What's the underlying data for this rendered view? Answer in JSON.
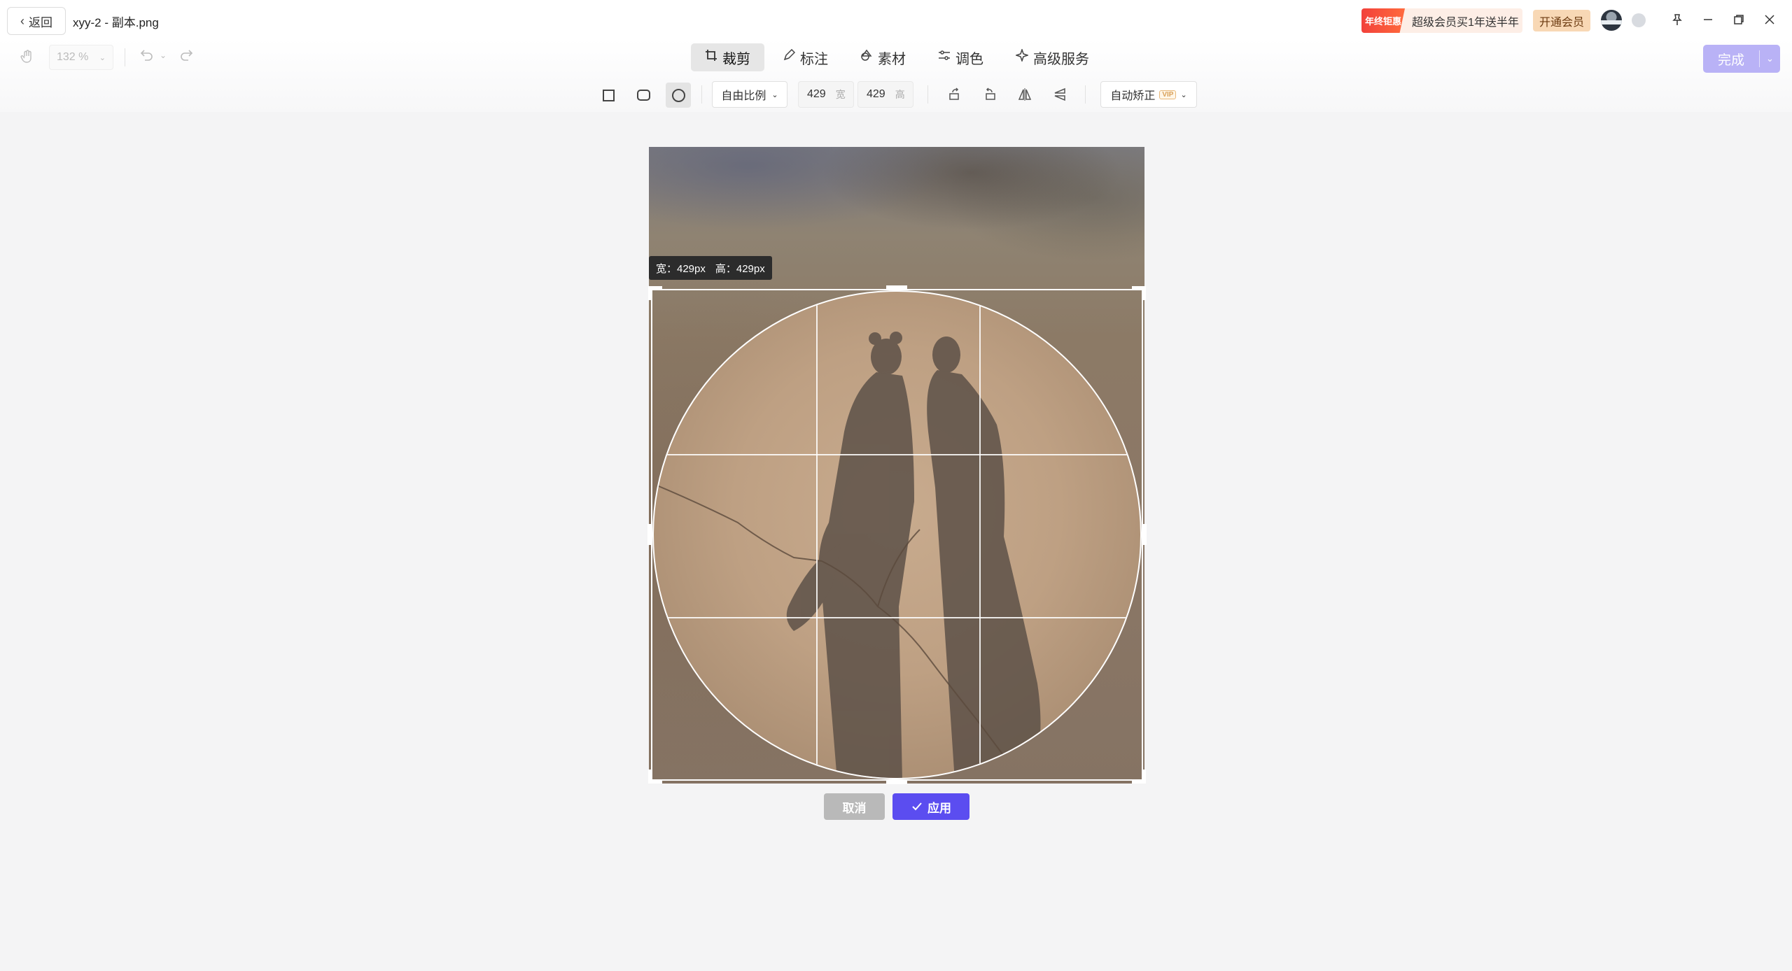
{
  "header": {
    "back_label": "返回",
    "file_name": "xyy-2 - 副本.png",
    "promo_tag": "年终钜惠",
    "promo_text": "超级会员买1年送半年",
    "vip_button": "开通会员"
  },
  "toolbar": {
    "zoom": "132 %",
    "tabs": [
      {
        "label": "裁剪",
        "icon": "crop-icon"
      },
      {
        "label": "标注",
        "icon": "pen-icon"
      },
      {
        "label": "素材",
        "icon": "shapes-icon"
      },
      {
        "label": "调色",
        "icon": "sliders-icon"
      },
      {
        "label": "高级服务",
        "icon": "sparkle-icon"
      }
    ],
    "done_label": "完成"
  },
  "crop_toolbar": {
    "ratio": "自由比例",
    "width_value": "429",
    "width_unit": "宽",
    "height_value": "429",
    "height_unit": "高",
    "auto_straighten": "自动矫正",
    "vip_badge": "VIP"
  },
  "canvas": {
    "size_tip_width": "宽：429px",
    "size_tip_height": "高：429px",
    "cancel_label": "取消",
    "apply_label": "应用"
  },
  "colors": {
    "accent": "#5b4df0",
    "done_disabled": "#b9b2f6",
    "promo_red": "#f2413b"
  }
}
